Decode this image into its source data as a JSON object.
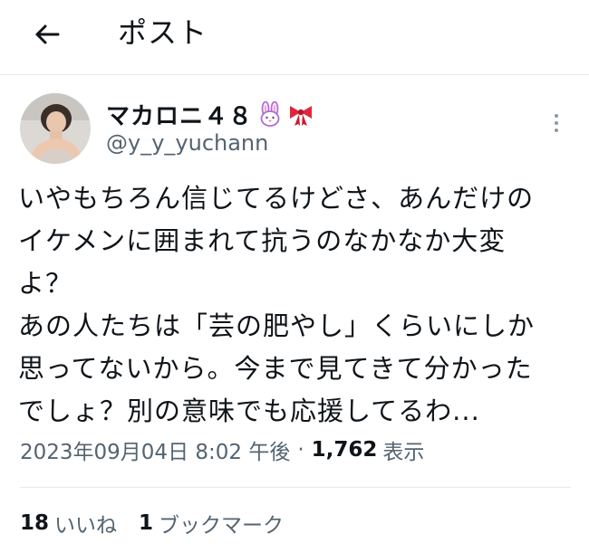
{
  "header": {
    "title": "ポスト",
    "back_icon": "arrow-left-icon"
  },
  "author": {
    "display_name": "マカロニ４８",
    "emojis": [
      "rabbit-face-icon",
      "ribbon-icon"
    ],
    "handle": "@y_y_yuchann"
  },
  "tweet": {
    "lines": [
      "いやもちろん信じてるけどさ、あんだけの",
      "イケメンに囲まれて抗うのなかなか大変",
      "よ？",
      "あの人たちは「芸の肥やし」くらいにしか",
      "思ってないから。今まで見てきて分かった",
      "でしょ？別の意味でも応援してるわ..."
    ]
  },
  "meta": {
    "timestamp": "2023年09月04日 8:02 午後",
    "separator": "·",
    "views_count": "1,762",
    "views_label": "表示"
  },
  "stats": {
    "likes_count": "18",
    "likes_label": "いいね",
    "bookmarks_count": "1",
    "bookmarks_label": "ブックマーク"
  },
  "colors": {
    "text": "#0f1419",
    "secondary": "#536471",
    "border": "#e6e9ec"
  }
}
